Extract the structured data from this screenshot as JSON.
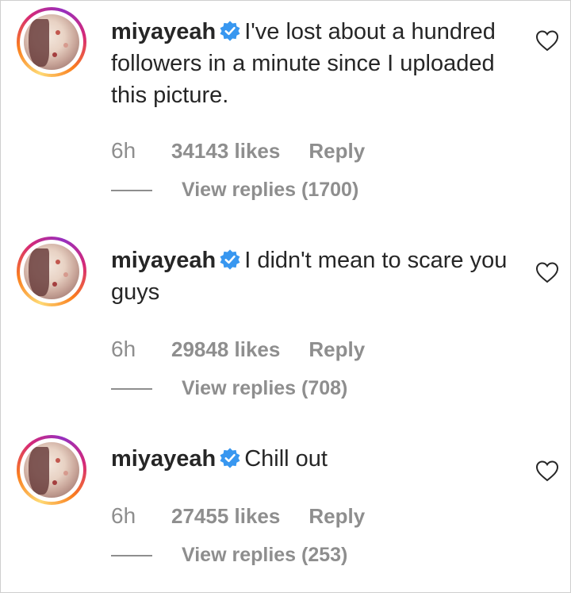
{
  "comments": [
    {
      "username": "miyayeah",
      "text": "I've lost about a hundred followers in a minute since I uploaded this picture.",
      "time": "6h",
      "likes": "34143 likes",
      "reply": "Reply",
      "view_replies": "View replies (1700)"
    },
    {
      "username": "miyayeah",
      "text": "I didn't mean to scare you guys",
      "time": "6h",
      "likes": "29848 likes",
      "reply": "Reply",
      "view_replies": "View replies (708)"
    },
    {
      "username": "miyayeah",
      "text": "Chill out",
      "time": "6h",
      "likes": "27455 likes",
      "reply": "Reply",
      "view_replies": "View replies (253)"
    }
  ],
  "icons": {
    "verified": "verified-badge-icon",
    "like": "heart-outline-icon"
  },
  "colors": {
    "verified_blue": "#3897f0",
    "secondary_text": "#8e8e8e",
    "primary_text": "#262626"
  }
}
